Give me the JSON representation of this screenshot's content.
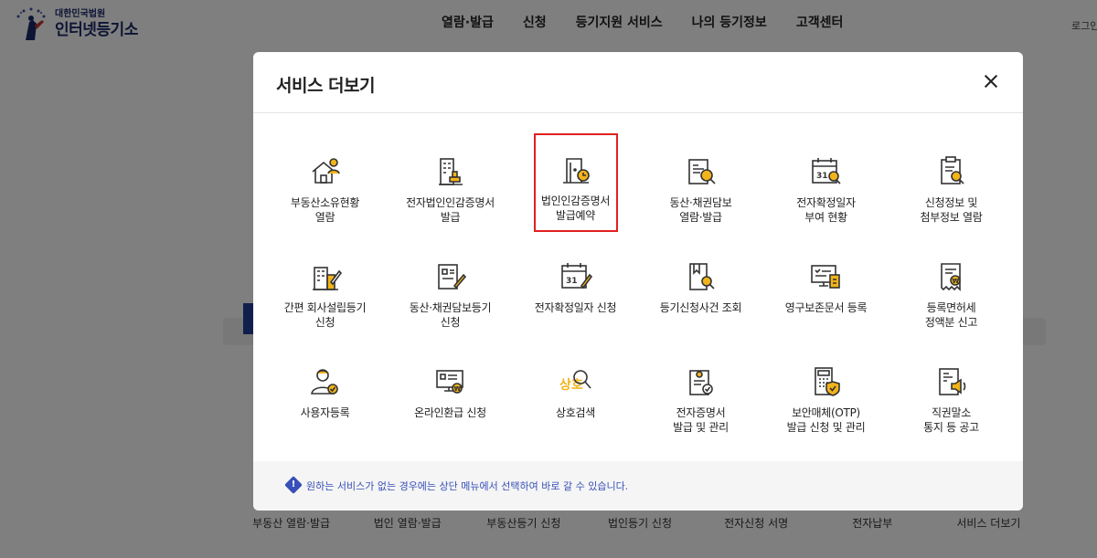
{
  "site": {
    "org": "대한민국법원",
    "name": "인터넷등기소",
    "nav": [
      "열람·발급",
      "신청",
      "등기지원 서비스",
      "나의 등기정보",
      "고객센터"
    ],
    "login": "로그인"
  },
  "quick_menu": [
    "부동산 열람·발급",
    "법인 열람·발급",
    "부동산등기 신청",
    "법인등기 신청",
    "전자신청 서명",
    "전자납부",
    "서비스 더보기"
  ],
  "modal": {
    "title": "서비스 더보기",
    "services": [
      {
        "label": "부동산소유현황\n열람",
        "icon": "house-person-icon"
      },
      {
        "label": "전자법인인감증명서\n발급",
        "icon": "building-stamp-icon"
      },
      {
        "label": "법인인감증명서\n발급예약",
        "icon": "door-clock-icon",
        "highlighted": true
      },
      {
        "label": "동산·채권담보\n열람·발급",
        "icon": "document-search-icon"
      },
      {
        "label": "전자확정일자\n부여 현황",
        "icon": "calendar-search-icon"
      },
      {
        "label": "신청정보 및\n첨부정보 열람",
        "icon": "clipboard-search-icon"
      },
      {
        "label": "간편 회사설립등기\n신청",
        "icon": "building-pen-icon"
      },
      {
        "label": "동산·채권담보등기\n신청",
        "icon": "document-pen-icon"
      },
      {
        "label": "전자확정일자 신청",
        "icon": "calendar-pen-icon"
      },
      {
        "label": "등기신청사건 조회",
        "icon": "book-search-icon"
      },
      {
        "label": "영구보존문서 등록",
        "icon": "monitor-document-icon"
      },
      {
        "label": "등록면허세\n정액분 신고",
        "icon": "receipt-won-icon"
      },
      {
        "label": "사용자등록",
        "icon": "user-check-icon"
      },
      {
        "label": "온라인환급 신청",
        "icon": "screen-won-icon"
      },
      {
        "label": "상호검색",
        "icon": "name-search-icon"
      },
      {
        "label": "전자증명서\n발급 및 관리",
        "icon": "certificate-check-icon"
      },
      {
        "label": "보안매체(OTP)\n발급 신청 및 관리",
        "icon": "otp-shield-icon"
      },
      {
        "label": "직권말소\n통지 등 공고",
        "icon": "document-speaker-icon"
      }
    ],
    "footer_text": "원하는 서비스가 없는 경우에는 상단 메뉴에서 선택하여 바로 갈 수 있습니다.",
    "icon_text_sangho": "상호",
    "icon_text_31": "31"
  },
  "colors": {
    "accent": "#f2b31b",
    "highlight": "#e02020",
    "footer_text": "#3850b7"
  }
}
